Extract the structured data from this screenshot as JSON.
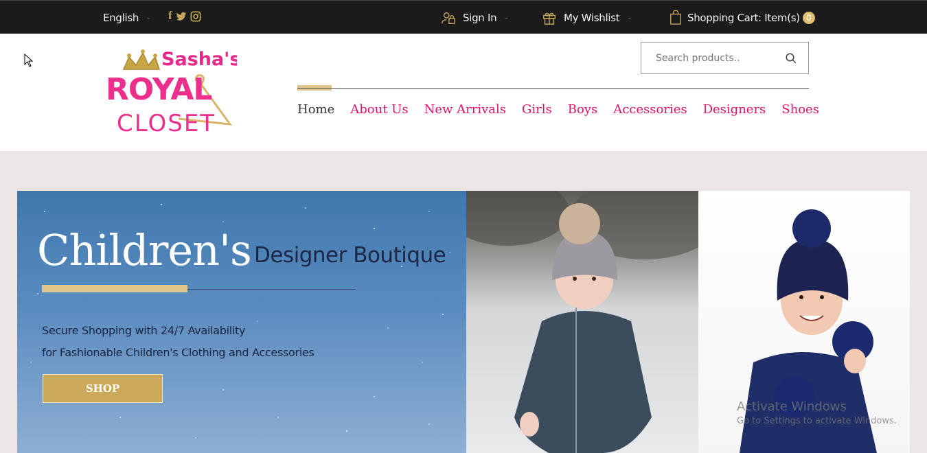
{
  "topbar": {
    "language": "English",
    "social_icons": [
      "facebook-icon",
      "twitter-icon",
      "instagram-icon"
    ],
    "sign_in": "Sign In",
    "wishlist": "My Wishlist",
    "cart": "Shopping Cart: Item(s)",
    "cart_count": "0"
  },
  "header": {
    "logo_text": {
      "line1": "Sasha's",
      "line2": "ROYAL",
      "line3": "CLOSET"
    },
    "search_placeholder": "Search products..",
    "nav": [
      "Home",
      "About Us",
      "New Arrivals",
      "Girls",
      "Boys",
      "Accessories",
      "Designers",
      "Shoes"
    ]
  },
  "hero": {
    "title_big": "Children's",
    "title_small": "Designer Boutique",
    "subtitle_line1": "Secure Shopping with 24/7 Availability",
    "subtitle_line2": "for Fashionable Children's Clothing and Accessories",
    "shop_button": "SHOP"
  },
  "watermark": {
    "line1": "Activate Windows",
    "line2": "Go to Settings to activate Windows."
  },
  "colors": {
    "accent_pink": "#e3156a",
    "accent_gold": "#c8a95c",
    "topbar_bg": "#1b1b1b"
  }
}
